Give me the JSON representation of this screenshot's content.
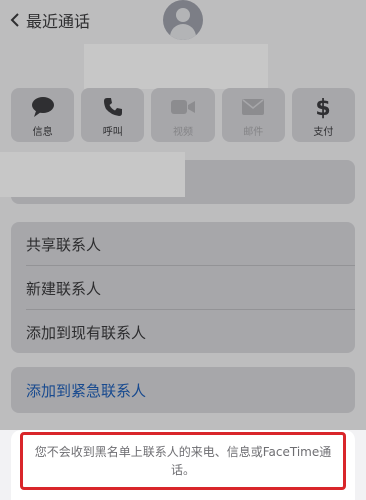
{
  "nav": {
    "back_label": "最近通话"
  },
  "actions": [
    {
      "label": "信息",
      "icon": "message-icon",
      "enabled": true
    },
    {
      "label": "呼叫",
      "icon": "phone-icon",
      "enabled": true
    },
    {
      "label": "视频",
      "icon": "video-icon",
      "enabled": false
    },
    {
      "label": "邮件",
      "icon": "mail-icon",
      "enabled": false
    },
    {
      "label": "支付",
      "icon": "dollar-icon",
      "enabled": true
    }
  ],
  "contact_options": [
    {
      "label": "共享联系人"
    },
    {
      "label": "新建联系人"
    },
    {
      "label": "添加到现有联系人"
    }
  ],
  "emergency": {
    "label": "添加到紧急联系人"
  },
  "blocklist_notice": {
    "text": "您不会收到黑名单上联系人的来电、信息或FaceTime通话。"
  },
  "colors": {
    "link": "#1f5fb8",
    "highlight_border": "#d9262a"
  }
}
